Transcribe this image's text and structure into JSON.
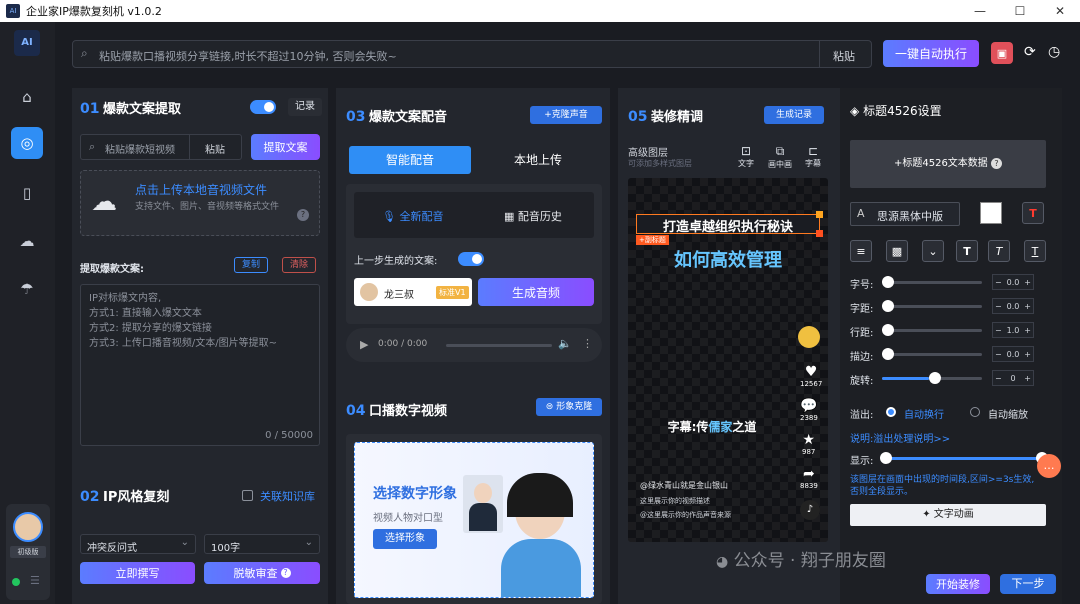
{
  "window": {
    "title": "企业家IP爆款复刻机 v1.0.2",
    "app_icon_text": "AI"
  },
  "sidebar": {
    "logo_text": "AI",
    "user_badge": "初级版"
  },
  "topbar": {
    "url_placeholder": "粘贴爆款口播视频分享链接,时长不超过10分钟, 否则会失败~",
    "paste_label": "粘贴",
    "auto_run_label": "一键自动执行"
  },
  "s01": {
    "num": "01",
    "title": "爆款文案提取",
    "record_label": "记录",
    "search_placeholder": "粘贴爆款短视频",
    "paste_label": "粘贴",
    "extract_label": "提取文案",
    "upload_title": "点击上传本地音视频文件",
    "upload_sub": "支持文件、图片、音视频等格式文件",
    "extract_label2": "提取爆款文案:",
    "copy_label": "复制",
    "clear_label": "清除",
    "textarea_lines": [
      "IP对标爆文内容,",
      "方式1: 直接输入爆文文本",
      "方式2: 提取分享的爆文链接",
      "方式3: 上传口播音视频/文本/图片等提取~"
    ],
    "count": "0 / 50000"
  },
  "s02": {
    "num": "02",
    "title": "IP风格复刻",
    "kb_label": "关联知识库",
    "style_value": "冲突反问式",
    "length_value": "100字",
    "write_label": "立即撰写",
    "sensitive_label": "脱敏审查"
  },
  "s03": {
    "num": "03",
    "title": "爆款文案配音",
    "clone_voice_label": "+克隆声音",
    "tab_smart": "智能配音",
    "tab_local": "本地上传",
    "new_dub": "全新配音",
    "dub_history": "配音历史",
    "prev_text_label": "上一步生成的文案:",
    "voice_name": "龙三叔",
    "voice_tag": "标准V1",
    "gen_audio_label": "生成音频",
    "audio_time": "0:00 / 0:00"
  },
  "s04": {
    "num": "04",
    "title": "口播数字视频",
    "avatar_clone_label": "形象克隆",
    "banner_title": "选择数字形象",
    "banner_sub": "视频人物对口型",
    "banner_btn": "选择形象"
  },
  "s05": {
    "num": "05",
    "title": "装修精调",
    "gen_record_label": "生成记录",
    "adv_layers": "高级图层",
    "adv_sub": "可添加多样式图层",
    "tool_text": "文字",
    "tool_pip": "画中画",
    "tool_caption": "字幕",
    "phone_top": "打造卓越组织执行秘诀",
    "phone_sub_tag": "+副标题",
    "phone_title": "如何高效管理",
    "caption_prefix": "字幕:传",
    "caption_hl": "儒家",
    "caption_suffix": "之道",
    "like_count": "12567",
    "comment_count": "2389",
    "fav_count": "987",
    "share_count": "8839",
    "footer_user": "@绿水青山就是金山银山",
    "footer_desc": "这里展示你的视频描述",
    "footer_work": "@这里展示你的作品声音来源"
  },
  "settings": {
    "title": "标题4526设置",
    "data_btn": "+标题4526文本数据",
    "font_name": "思源黑体中版",
    "rows": [
      {
        "label": "字号:",
        "value": "0.0",
        "fill": 0.0
      },
      {
        "label": "字距:",
        "value": "0.0",
        "fill": 0.0
      },
      {
        "label": "行距:",
        "value": "1.0",
        "fill": 0.0
      },
      {
        "label": "描边:",
        "value": "0.0",
        "fill": 0.0
      },
      {
        "label": "旋转:",
        "value": "0",
        "fill": 0.5
      }
    ],
    "overflow_label": "溢出:",
    "auto_wrap": "自动换行",
    "auto_scale": "自动缩放",
    "overflow_link": "说明:溢出处理说明>>",
    "show_label": "显示:",
    "show_note": "该图层在画面中出现的时间段,区间>=3s生效, 否则全段显示。",
    "text_anim": "文字动画"
  },
  "bottom": {
    "start_label": "开始装修",
    "next_label": "下一步",
    "watermark": "公众号 · 翔子朋友圈"
  },
  "colors": {
    "accent": "#3c8cff",
    "purple": "#8a4dff",
    "red": "#ff3b30"
  }
}
